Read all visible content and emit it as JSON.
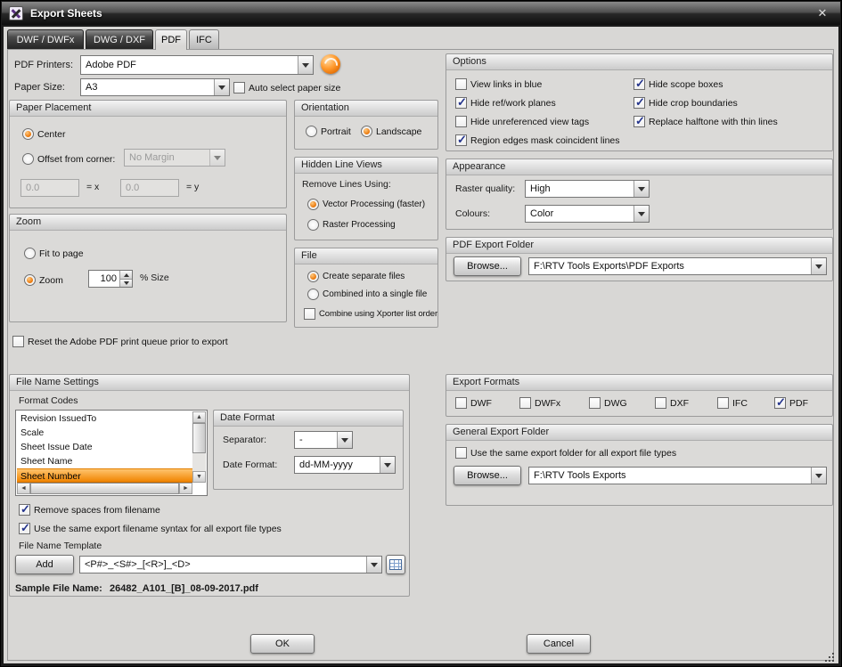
{
  "window": {
    "title": "Export Sheets",
    "close_glyph": "✕"
  },
  "tabs": {
    "dwf": "DWF / DWFx",
    "dwg": "DWG / DXF",
    "pdf": "PDF",
    "ifc": "IFC"
  },
  "printer_row": {
    "label": "PDF Printers:",
    "value": "Adobe PDF"
  },
  "paper_row": {
    "label": "Paper Size:",
    "value": "A3",
    "auto_checkbox": "Auto select paper size",
    "auto_checked": false
  },
  "paper_placement": {
    "title": "Paper Placement",
    "center_label": "Center",
    "center_selected": true,
    "offset_label": "Offset from corner:",
    "offset_selected": false,
    "margin_value": "No Margin",
    "x_value": "0.0",
    "x_suffix": "= x",
    "y_value": "0.0",
    "y_suffix": "= y"
  },
  "orientation": {
    "title": "Orientation",
    "portrait": "Portrait",
    "portrait_selected": false,
    "landscape": "Landscape",
    "landscape_selected": true
  },
  "hidden_line_views": {
    "title": "Hidden Line Views",
    "caption": "Remove Lines Using:",
    "vector": "Vector Processing (faster)",
    "vector_selected": true,
    "raster": "Raster Processing",
    "raster_selected": false
  },
  "zoom": {
    "title": "Zoom",
    "fit": "Fit to page",
    "fit_selected": false,
    "zoom": "Zoom",
    "zoom_selected": true,
    "value": "100",
    "suffix": "% Size"
  },
  "file": {
    "title": "File",
    "separate": "Create separate files",
    "separate_selected": true,
    "combined": "Combined into a single file",
    "combined_selected": false,
    "combine_order": "Combine using Xporter list order",
    "combine_order_checked": false
  },
  "reset_queue": {
    "label": "Reset the Adobe PDF print queue prior to export",
    "checked": false
  },
  "options": {
    "title": "Options",
    "col1": [
      {
        "label": "View links in blue",
        "checked": false
      },
      {
        "label": "Hide ref/work planes",
        "checked": true
      },
      {
        "label": "Hide unreferenced view tags",
        "checked": false
      },
      {
        "label": "Region edges mask coincident lines",
        "checked": true
      }
    ],
    "col2": [
      {
        "label": "Hide scope boxes",
        "checked": true
      },
      {
        "label": "Hide crop boundaries",
        "checked": true
      },
      {
        "label": "Replace halftone with thin lines",
        "checked": true
      }
    ]
  },
  "appearance": {
    "title": "Appearance",
    "raster_label": "Raster quality:",
    "raster_value": "High",
    "colours_label": "Colours:",
    "colours_value": "Color"
  },
  "pdf_export_folder": {
    "title": "PDF Export Folder",
    "browse": "Browse...",
    "path": "F:\\RTV Tools Exports\\PDF Exports"
  },
  "file_name_settings": {
    "title": "File Name Settings",
    "format_codes_label": "Format Codes",
    "codes": [
      {
        "label": "Revision IssuedTo",
        "selected": false
      },
      {
        "label": "Scale",
        "selected": false
      },
      {
        "label": "Sheet Issue Date",
        "selected": false
      },
      {
        "label": "Sheet Name",
        "selected": false
      },
      {
        "label": "Sheet Number",
        "selected": true
      }
    ],
    "date_format": {
      "title": "Date Format",
      "separator_label": "Separator:",
      "separator_value": "-",
      "format_label": "Date Format:",
      "format_value": "dd-MM-yyyy"
    },
    "remove_spaces": {
      "label": "Remove spaces from filename",
      "checked": true
    },
    "same_syntax": {
      "label": "Use the same export filename syntax for all export file types",
      "checked": true
    },
    "template_label": "File Name Template",
    "add_button": "Add",
    "template_value": "<P#>_<S#>_[<R>]_<D>",
    "sample_label": "Sample File Name:",
    "sample_value": "26482_A101_[B]_08-09-2017.pdf"
  },
  "export_formats": {
    "title": "Export Formats",
    "items": [
      {
        "label": "DWF",
        "checked": false
      },
      {
        "label": "DWFx",
        "checked": false
      },
      {
        "label": "DWG",
        "checked": false
      },
      {
        "label": "DXF",
        "checked": false
      },
      {
        "label": "IFC",
        "checked": false
      },
      {
        "label": "PDF",
        "checked": true
      }
    ]
  },
  "general_export_folder": {
    "title": "General Export Folder",
    "same_folder": {
      "label": "Use the same export folder for all export file types",
      "checked": false
    },
    "browse": "Browse...",
    "path": "F:\\RTV Tools Exports"
  },
  "footer": {
    "ok": "OK",
    "cancel": "Cancel"
  }
}
